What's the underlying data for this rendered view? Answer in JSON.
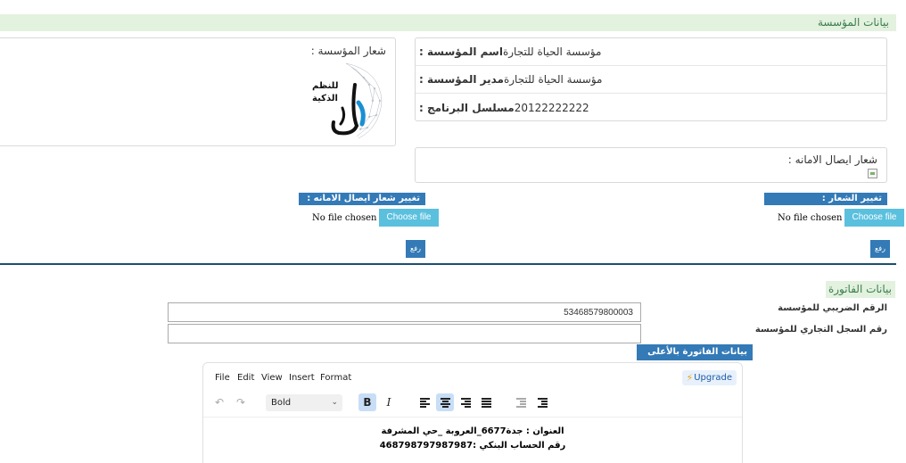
{
  "org_section": {
    "title": "بيانات المؤسسة"
  },
  "org_info": {
    "rows": [
      {
        "label": "اسم المؤسسة :",
        "value": "مؤسسة الحياة للتجارة"
      },
      {
        "label": "مدير المؤسسة :",
        "value": "مؤسسة الحياة للتجارة"
      },
      {
        "label": "مسلسل البرنامج :",
        "value": "20122222222"
      }
    ]
  },
  "logo_panel": {
    "label": "شعار المؤسسة :",
    "logo_text_line1": "للنظم",
    "logo_text_line2": "الذكية",
    "logo_mark": "البدر"
  },
  "safe_logo_panel": {
    "label": "شعار ايصال الامانه :"
  },
  "change_logo": {
    "label": "تغيير الشعار :",
    "no_file": "No file chosen",
    "choose": "Choose file",
    "upload": "رفع"
  },
  "change_safe_logo": {
    "label": "تغيير شعار ايصال الامانه :",
    "no_file": "No file chosen",
    "choose": "Choose file",
    "upload": "رفع"
  },
  "invoice_section": {
    "title": "بيانات الفاتورة"
  },
  "invoice_fields": {
    "tax_label": "الرقم الضريبي للمؤسسة",
    "tax_value": "53468579800003",
    "cr_label": "رقم السجل التجاري للمؤسسة",
    "cr_value": ""
  },
  "editor": {
    "top_label": "بيانات الفاتورة بالأعلى",
    "menu": [
      "File",
      "Edit",
      "View",
      "Insert",
      "Format"
    ],
    "upgrade": "Upgrade",
    "block_format": "Bold",
    "bold_glyph": "B",
    "italic_glyph": "I",
    "content_line1": "العنوان : جدة6677_العروبة _حي المشرفة",
    "content_line2": "رقم الحساب البنكي :468798797987987",
    "colors": {
      "active_button": "#c8def7",
      "upgrade_bg": "#e8f1fb"
    }
  },
  "colors": {
    "section_bg": "#e3f1df",
    "primary": "#337ab7",
    "info": "#5bc0de",
    "divider": "#1b4f72"
  }
}
